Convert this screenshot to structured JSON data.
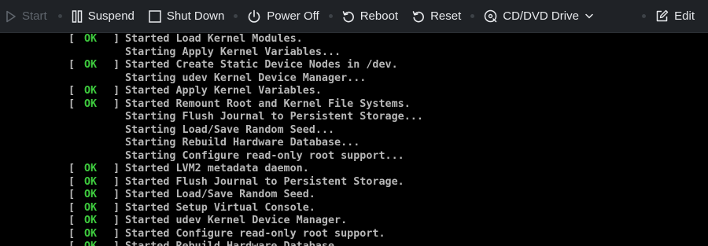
{
  "toolbar": {
    "start": "Start",
    "suspend": "Suspend",
    "shutdown": "Shut Down",
    "poweroff": "Power Off",
    "reboot": "Reboot",
    "reset": "Reset",
    "cddvd": "CD/DVD Drive",
    "edit": "Edit"
  },
  "console": {
    "status_ok": "OK",
    "lines": [
      {
        "ok": true,
        "text": "Started Load Kernel Modules."
      },
      {
        "ok": false,
        "text": "Starting Apply Kernel Variables..."
      },
      {
        "ok": true,
        "text": "Started Create Static Device Nodes in /dev."
      },
      {
        "ok": false,
        "text": "Starting udev Kernel Device Manager..."
      },
      {
        "ok": true,
        "text": "Started Apply Kernel Variables."
      },
      {
        "ok": true,
        "text": "Started Remount Root and Kernel File Systems."
      },
      {
        "ok": false,
        "text": "Starting Flush Journal to Persistent Storage..."
      },
      {
        "ok": false,
        "text": "Starting Load/Save Random Seed..."
      },
      {
        "ok": false,
        "text": "Starting Rebuild Hardware Database..."
      },
      {
        "ok": false,
        "text": "Starting Configure read-only root support..."
      },
      {
        "ok": true,
        "text": "Started LVM2 metadata daemon."
      },
      {
        "ok": true,
        "text": "Started Flush Journal to Persistent Storage."
      },
      {
        "ok": true,
        "text": "Started Load/Save Random Seed."
      },
      {
        "ok": true,
        "text": "Started Setup Virtual Console."
      },
      {
        "ok": true,
        "text": "Started udev Kernel Device Manager."
      },
      {
        "ok": true,
        "text": "Started Configure read-only root support."
      },
      {
        "ok": true,
        "text": "Started Rebuild Hardware Database."
      }
    ]
  }
}
